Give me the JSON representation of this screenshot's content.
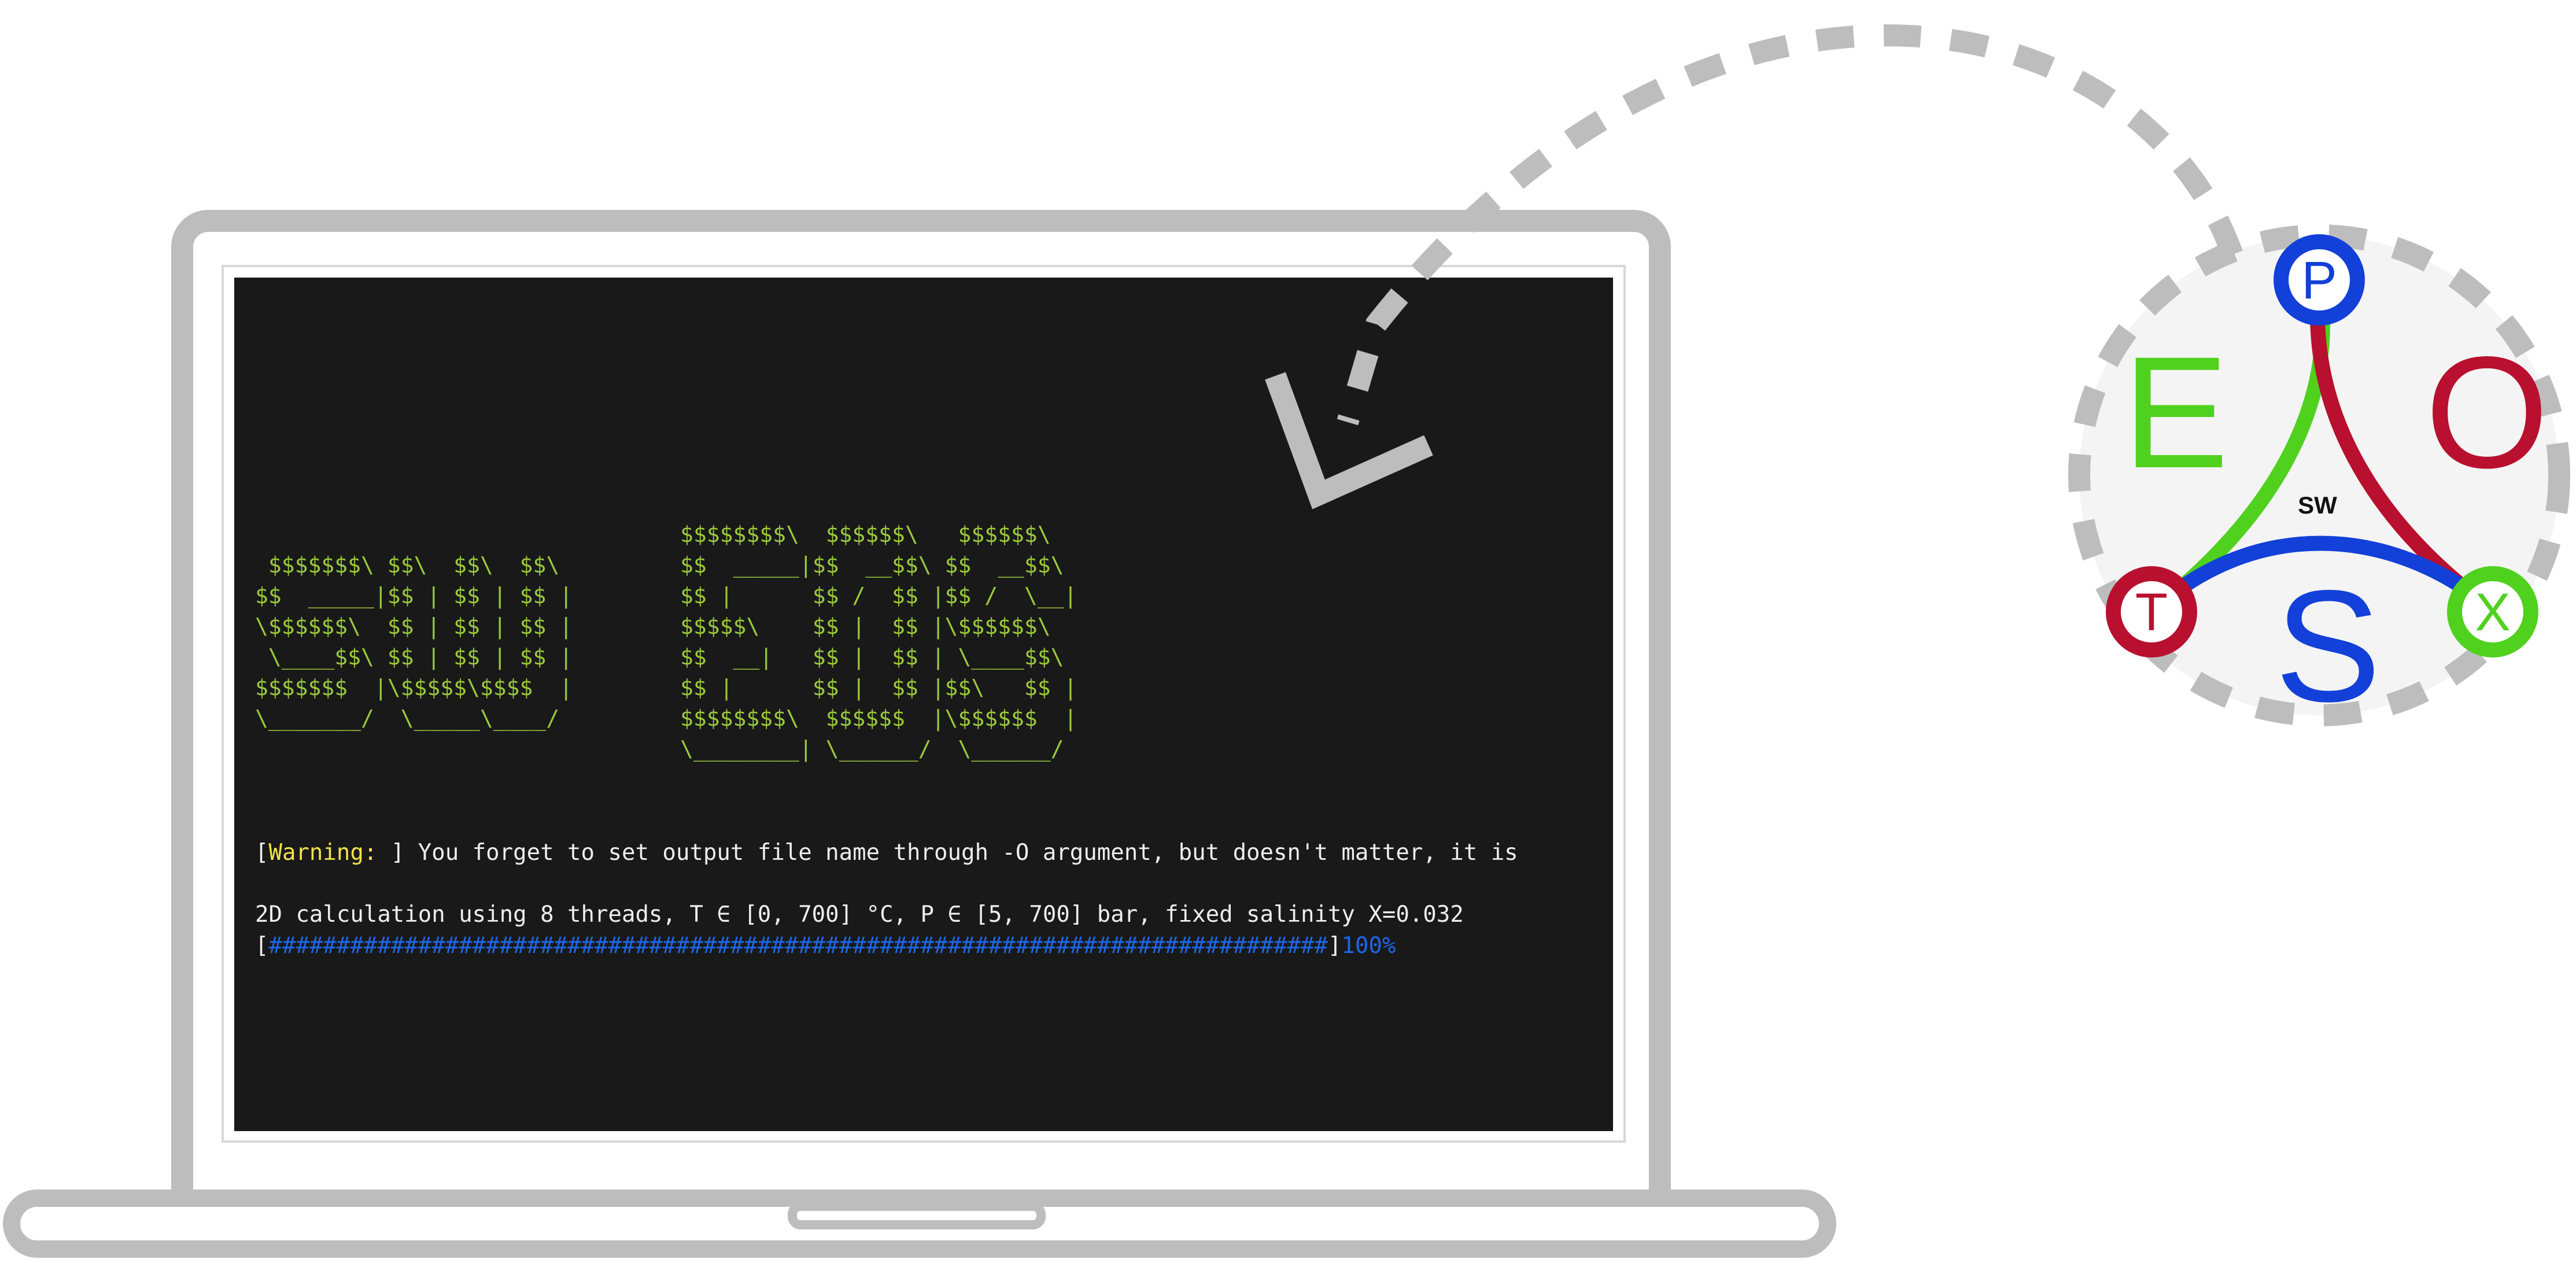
{
  "terminal": {
    "banner_left": " $$$$$$$\\ $$\\  $$\\  $$\\ \n$$  _____|$$ | $$ | $$ |\n\\$$$$$$\\  $$ | $$ | $$ |\n \\____$$\\ $$ | $$ | $$ |\n$$$$$$$  |\\$$$$$\\$$$$  |\n\\_______/  \\_____\\____/ ",
    "banner_right": "$$$$$$$$\\  $$$$$$\\   $$$$$$\\ \n$$  _____|$$  __$$\\ $$  __$$\\\n$$ |      $$ /  $$ |$$ /  \\__|\n$$$$$\\    $$ |  $$ |\\$$$$$$\\ \n$$  __|   $$ |  $$ | \\____$$\\\n$$ |      $$ |  $$ |$$\\   $$ |\n$$$$$$$$\\  $$$$$$  |\\$$$$$$  |\n\\________| \\______/  \\______/ ",
    "warning_open": "[",
    "warning_tag": "Warning: ",
    "warning_text": "] You forget to set output file name through -O argument, but doesn't matter, it is",
    "calc_line": "2D calculation using 8 threads, T ∈ [0, 700] °C, P ∈ [5, 700] bar, fixed salinity X=0.032",
    "progress_open": "[",
    "progress_bar": "##############################################################################",
    "progress_close": "]",
    "progress_percent": "100%",
    "progress_value": 1.0
  },
  "logo": {
    "letter_e": "E",
    "letter_o": "O",
    "letter_s": "S",
    "center_label": "SW",
    "node_p": "P",
    "node_t": "T",
    "node_x": "X"
  },
  "colors": {
    "terminal_bg": "#191919",
    "banner_text": "#9ac93a",
    "warning_tag": "#f2e24a",
    "progress": "#1e66e6",
    "logo_green": "#4fd11e",
    "logo_red": "#b8102e",
    "logo_blue": "#1240d8",
    "frame_gray": "#bdbdbd"
  }
}
